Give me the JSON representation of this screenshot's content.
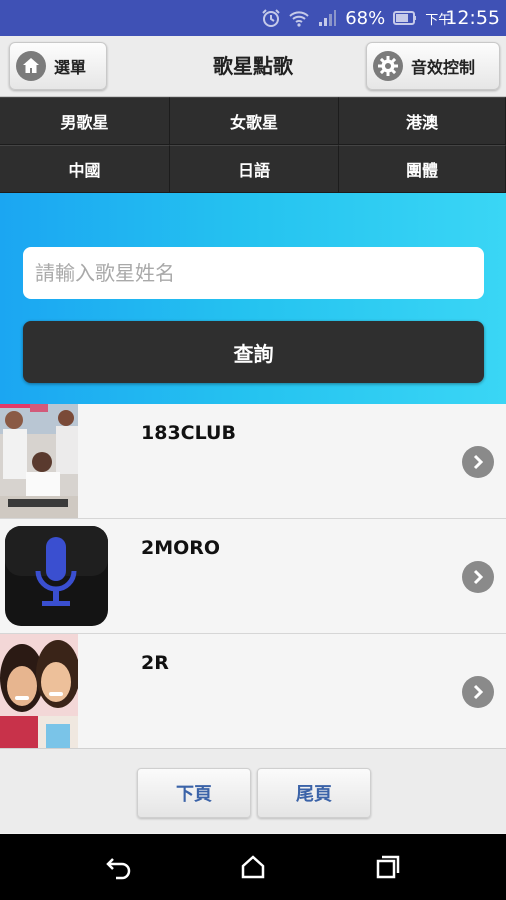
{
  "status_bar": {
    "battery": "68%",
    "time_prefix": "下午",
    "time": "12:55",
    "icons": [
      "alarm-icon",
      "wifi-icon",
      "signal-icon",
      "battery-icon"
    ]
  },
  "header": {
    "home_label": "選單",
    "title": "歌星點歌",
    "fx_label": "音效控制"
  },
  "categories": [
    "男歌星",
    "女歌星",
    "港澳",
    "中國",
    "日語",
    "團體"
  ],
  "search": {
    "placeholder": "請輸入歌星姓名",
    "value": "",
    "button_label": "查詢"
  },
  "artists": [
    {
      "name": "183CLUB",
      "thumb": "group-photo"
    },
    {
      "name": "2MORO",
      "thumb": "microphone-icon"
    },
    {
      "name": "2R",
      "thumb": "duo-photo"
    }
  ],
  "pagination": {
    "next_label": "下頁",
    "last_label": "尾頁"
  },
  "colors": {
    "status_bar": "#3f51b5",
    "search_gradient_start": "#1ba6f2",
    "search_gradient_end": "#3ad6f5",
    "dark": "#2e2e2e",
    "link_blue": "#3b63a8"
  }
}
